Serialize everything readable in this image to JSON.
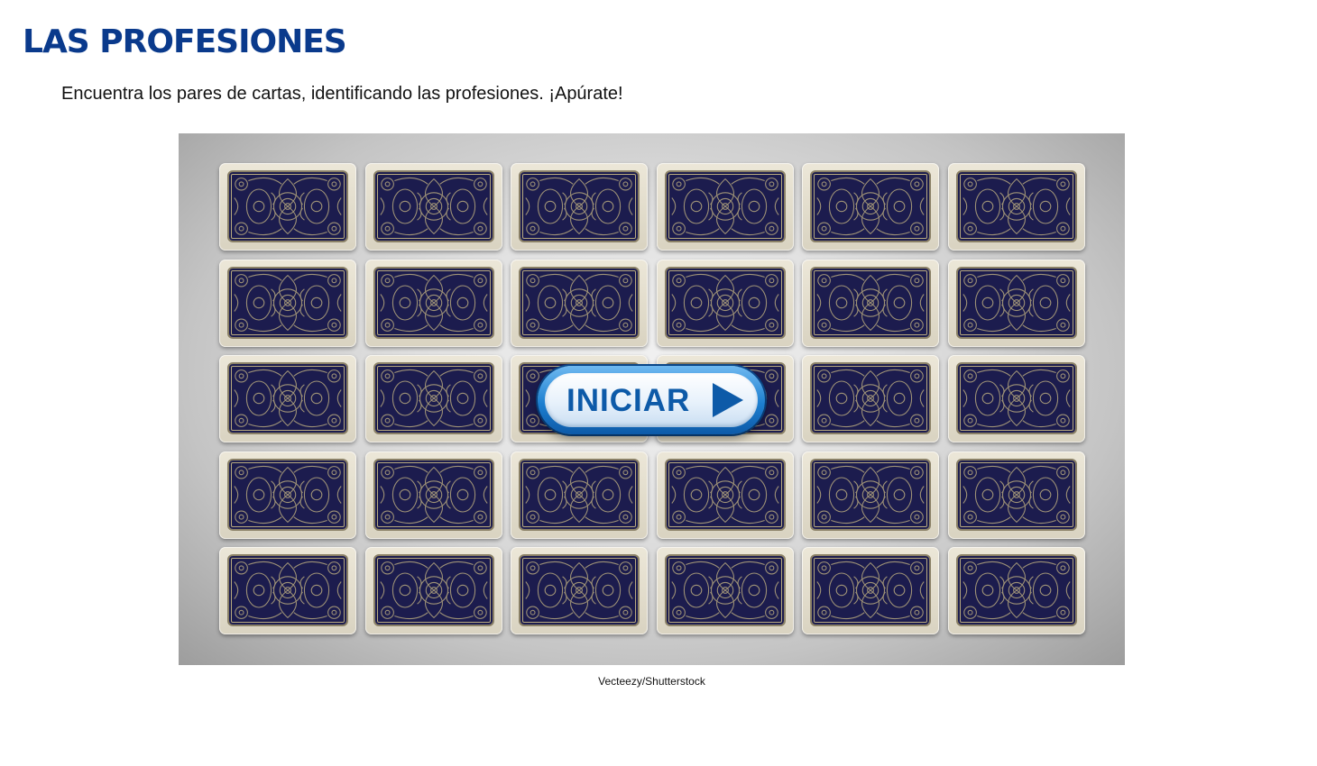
{
  "page": {
    "title": "LAS PROFESIONES",
    "instructions": "Encuentra los pares de cartas, identificando las profesiones. ¡Apúrate!"
  },
  "game": {
    "rows": 5,
    "columns": 6,
    "card_back": "ornate-pattern-icon",
    "start_button": {
      "label": "INICIAR",
      "icon": "play-icon"
    },
    "image_credit": "Vecteezy/Shutterstock"
  },
  "colors": {
    "title": "#0a3a8c",
    "card_back": "#1c1c4e",
    "card_ornament": "#b7a97f",
    "button_accent": "#0d5aa8"
  }
}
